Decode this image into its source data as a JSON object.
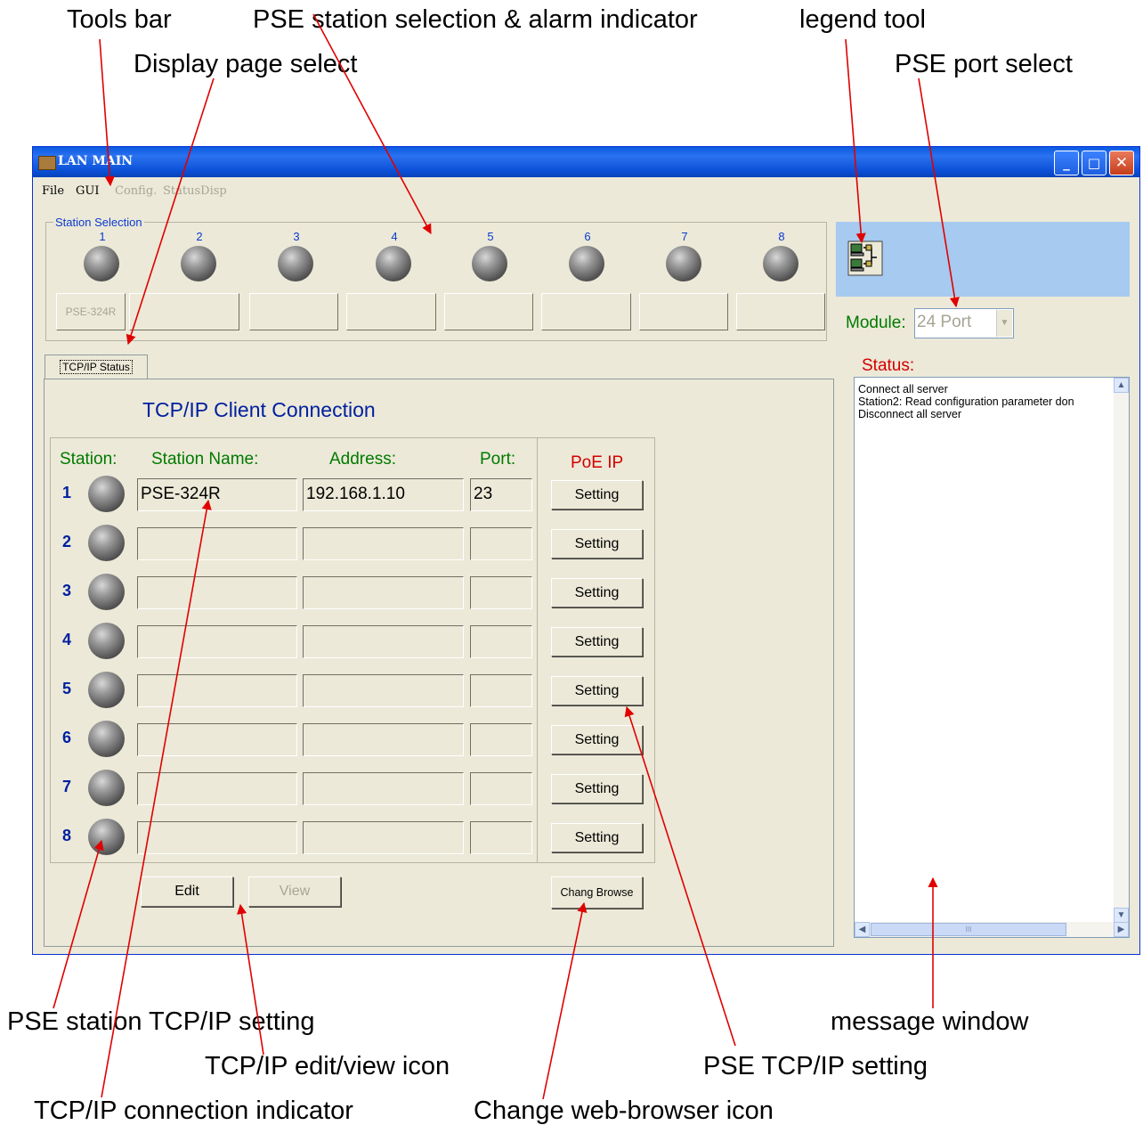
{
  "callouts": {
    "tools_bar": "Tools bar",
    "pse_station_selection": "PSE station selection & alarm indicator",
    "legend_tool": "legend tool",
    "display_page_select": "Display page select",
    "pse_port_select": "PSE port select",
    "pse_station_tcpip_setting": "PSE station TCP/IP setting",
    "message_window": "message window",
    "tcpip_edit_view_icon": "TCP/IP edit/view icon",
    "pse_tcpip_setting": "PSE TCP/IP setting",
    "tcpip_connection_indicator": "TCP/IP connection indicator",
    "change_web_browser_icon": "Change web-browser icon"
  },
  "window": {
    "title": "LAN MAIN",
    "controls": {
      "minimize": "_",
      "maximize": "□",
      "close": "✕"
    },
    "menu": [
      "File",
      "GUI",
      "Config.",
      "StatusDisp"
    ]
  },
  "station_selection": {
    "label": "Station Selection",
    "numbers": [
      "1",
      "2",
      "3",
      "4",
      "5",
      "6",
      "7",
      "8"
    ],
    "buttons": [
      "PSE-324R",
      "",
      "",
      "",
      "",
      "",
      "",
      ""
    ]
  },
  "module": {
    "label": "Module:",
    "value": "24 Port",
    "dropdown_arrow": "▼"
  },
  "tab": {
    "label": "TCP/IP Status"
  },
  "tcpip": {
    "title": "TCP/IP Client Connection",
    "headers": {
      "station": "Station:",
      "station_name": "Station Name:",
      "address": "Address:",
      "port": "Port:",
      "poe_ip": "PoE IP"
    },
    "rows": [
      {
        "num": "1",
        "name": "PSE-324R",
        "address": "192.168.1.10",
        "port": "23",
        "setting": "Setting"
      },
      {
        "num": "2",
        "name": "",
        "address": "",
        "port": "",
        "setting": "Setting"
      },
      {
        "num": "3",
        "name": "",
        "address": "",
        "port": "",
        "setting": "Setting"
      },
      {
        "num": "4",
        "name": "",
        "address": "",
        "port": "",
        "setting": "Setting"
      },
      {
        "num": "5",
        "name": "",
        "address": "",
        "port": "",
        "setting": "Setting"
      },
      {
        "num": "6",
        "name": "",
        "address": "",
        "port": "",
        "setting": "Setting"
      },
      {
        "num": "7",
        "name": "",
        "address": "",
        "port": "",
        "setting": "Setting"
      },
      {
        "num": "8",
        "name": "",
        "address": "",
        "port": "",
        "setting": "Setting"
      }
    ],
    "buttons": {
      "edit": "Edit",
      "view": "View",
      "chang_browse": "Chang Browse"
    }
  },
  "status": {
    "label": "Status:",
    "messages": [
      "Connect all server",
      "Station2: Read configuration parameter don",
      "Disconnect all server"
    ],
    "scroll": {
      "up": "▲",
      "down": "▼",
      "left": "◀",
      "right": "▶",
      "grip": "III"
    }
  },
  "colors": {
    "titlebar": "#0a4fd6",
    "window_bg": "#ece9d8",
    "legend_panel": "#a6caf0",
    "label_green": "#007a00",
    "label_blue": "#0020a0",
    "label_red": "#d40000",
    "annotation_arrow": "#e00000"
  },
  "icons": {
    "legend": "network-computers-icon",
    "led": "gray-led-indicator"
  }
}
